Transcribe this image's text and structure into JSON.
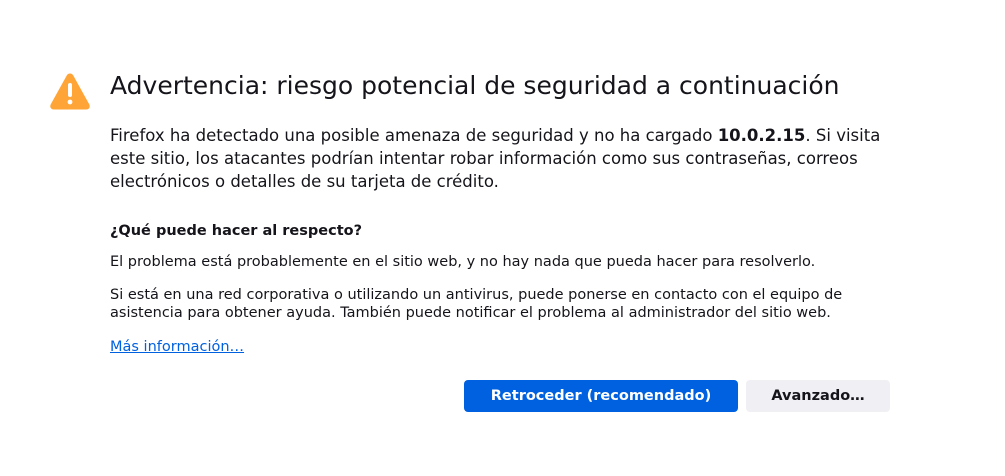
{
  "warning_icon": "warning-triangle-icon",
  "colors": {
    "warning": "#ffa436",
    "accent": "#0061e0",
    "secondary_button": "#f0f0f4",
    "text": "#15141a"
  },
  "title": "Advertencia: riesgo potencial de seguridad a continuación",
  "intro": {
    "before_host": "Firefox ha detectado una posible amenaza de seguridad y no ha cargado ",
    "host": "10.0.2.15",
    "after_host": ". Si visita este sitio, los atacantes podrían intentar robar información como sus contraseñas, correos electrónicos o detalles de su tarjeta de crédito."
  },
  "what_to_do": {
    "heading": "¿Qué puede hacer al respecto?",
    "paragraph1": "El problema está probablemente en el sitio web, y no hay nada que pueda hacer para resolverlo.",
    "paragraph2": "Si está en una red corporativa o utilizando un antivirus, puede ponerse en contacto con el equipo de asistencia para obtener ayuda. También puede notificar el problema al administrador del sitio web."
  },
  "learn_more_label": "Más información…",
  "buttons": {
    "go_back": "Retroceder (recomendado)",
    "advanced": "Avanzado…"
  }
}
